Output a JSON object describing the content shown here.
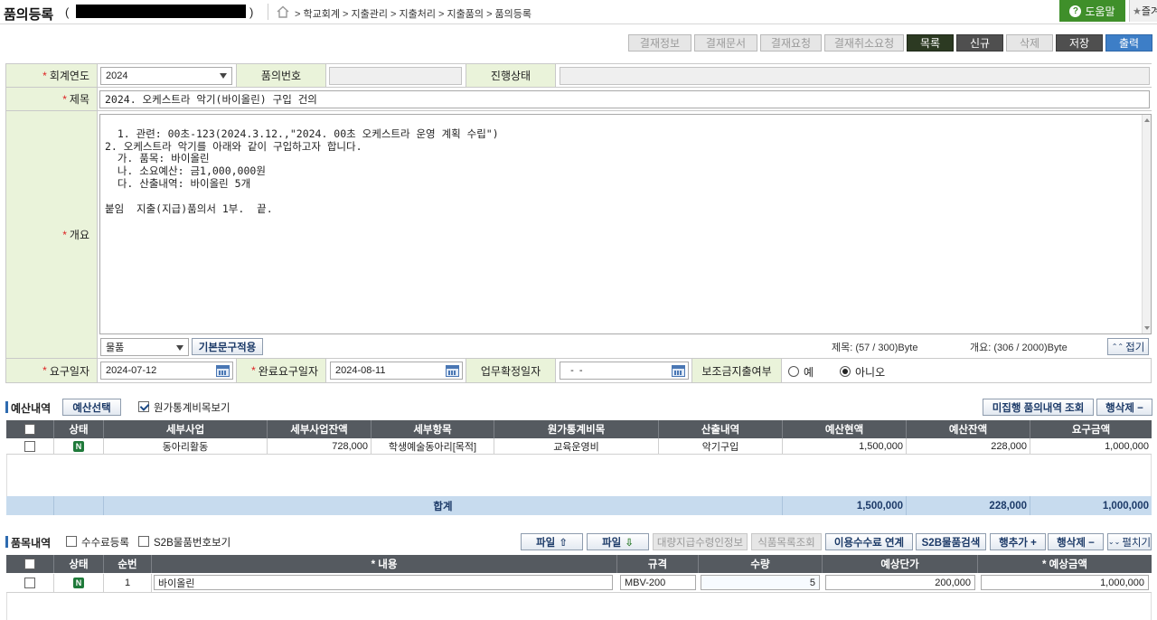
{
  "header": {
    "title": "품의등록",
    "paren_open": "(",
    "paren_close": ")",
    "breadcrumbs": "> 학교회계 > 지출관리 > 지출처리 > 지출품의 > 품의등록",
    "help_label": "도움말",
    "help_icon": "?",
    "fav_label": "즐겨"
  },
  "toolbar": {
    "buttons": [
      {
        "label": "결재정보",
        "state": "disabled"
      },
      {
        "label": "결재문서",
        "state": "disabled"
      },
      {
        "label": "결재요청",
        "state": "disabled"
      },
      {
        "label": "결재취소요청",
        "state": "disabled"
      },
      {
        "label": "목록",
        "state": "active"
      },
      {
        "label": "신규",
        "state": "active"
      },
      {
        "label": "삭제",
        "state": "disabled"
      },
      {
        "label": "저장",
        "state": "active"
      },
      {
        "label": "출력",
        "state": "active"
      }
    ]
  },
  "form": {
    "fiscal_year": {
      "label": "회계연도",
      "value": "2024"
    },
    "doc_no": {
      "label": "품의번호",
      "value": ""
    },
    "status": {
      "label": "진행상태",
      "value": ""
    },
    "subject": {
      "label": "제목",
      "value": "2024. 오케스트라 악기(바이올린) 구입 건의"
    },
    "summary": {
      "label": "개요",
      "text": "1. 관련: 00초-123(2024.3.12.,\"2024. 00초 오케스트라 운영 계획 수립\")\n2. 오케스트라 악기를 아래와 같이 구입하고자 합니다.\n  가. 품목: 바이올린\n  나. 소요예산: 금1,000,000원\n  다. 산출내역: 바이올린 5개\n\n붙임  지출(지급)품의서 1부.  끝."
    },
    "category": {
      "value": "물품"
    },
    "default_text_button": "기본문구적용",
    "subject_bytes": "제목: (57 / 300)Byte",
    "summary_bytes": "개요: (306 / 2000)Byte",
    "collapse_button": "접기",
    "request_date": {
      "label": "요구일자",
      "value": "2024-07-12"
    },
    "complete_date": {
      "label": "완료요구일자",
      "value": "2024-08-11"
    },
    "confirm_date": {
      "label": "업무확정일자",
      "value": "  -  -"
    },
    "subsidy": {
      "label": "보조금지출여부",
      "options": [
        "예",
        "아니오"
      ],
      "selected": "아니오"
    }
  },
  "budget": {
    "title": "예산내역",
    "select_button": "예산선택",
    "cost_check_label": "원가통계비목보기",
    "cost_checked": true,
    "unsettled_button": "미집행 품의내역 조회",
    "delete_row_button": "행삭제 −",
    "columns": [
      "",
      "상태",
      "세부사업",
      "세부사업잔액",
      "세부항목",
      "원가통계비목",
      "산출내역",
      "예산현액",
      "예산잔액",
      "요구금액"
    ],
    "rows": [
      {
        "status": "N",
        "project": "동아리활동",
        "project_balance": "728,000",
        "item": "학생예술동아리[목적]",
        "cost_item": "교육운영비",
        "calc": "악기구입",
        "budget_current": "1,500,000",
        "budget_balance": "228,000",
        "request": "1,000,000"
      }
    ],
    "total_label": "합계",
    "total_budget_current": "1,500,000",
    "total_budget_balance": "228,000",
    "total_request": "1,000,000"
  },
  "goods": {
    "title": "품목내역",
    "fee_label": "수수료등록",
    "s2b_label": "S2B물품번호보기",
    "buttons": {
      "file_upload": "파일",
      "file_download": "파일",
      "bulk_receipt": "대량지급수령인정보",
      "food_list": "식품목록조회",
      "fee_link": "이용수수료 연계",
      "s2b_search": "S2B물품검색",
      "add_row": "행추가 +",
      "delete_row": "행삭제 −",
      "expand": "펼치기"
    },
    "columns": [
      "",
      "상태",
      "순번",
      "* 내용",
      "규격",
      "수량",
      "예상단가",
      "* 예상금액"
    ],
    "rows": [
      {
        "status": "N",
        "seq": "1",
        "content": "바이올린",
        "spec": "MBV-200",
        "qty": "5",
        "unit_price": "200,000",
        "amount": "1,000,000"
      }
    ]
  }
}
